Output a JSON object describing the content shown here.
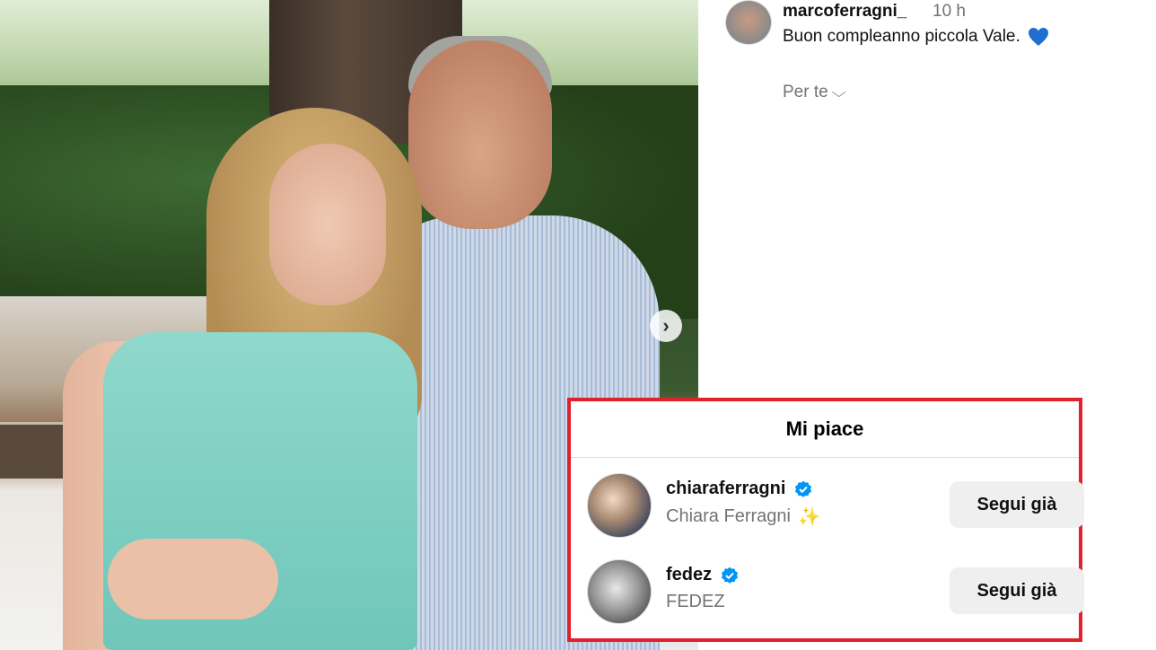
{
  "post": {
    "username": "marcoferragni_",
    "time": "10 h",
    "caption": "Buon compleanno piccola Vale.",
    "translate_label": "Per te"
  },
  "likes_dialog": {
    "title": "Mi piace",
    "users": [
      {
        "username": "chiaraferragni",
        "full_name": "Chiara Ferragni",
        "verified": true,
        "button_label": "Segui già"
      },
      {
        "username": "fedez",
        "full_name": "FEDEZ",
        "verified": true,
        "button_label": "Segui già"
      }
    ]
  },
  "colors": {
    "highlight_border": "#e0202d",
    "verified_badge": "#0095f6",
    "heart": "#1f6fd1"
  },
  "icons": [
    "chevron-right-icon",
    "chevron-down-icon",
    "blue-heart-icon",
    "verified-badge-icon",
    "sparkles-icon"
  ]
}
